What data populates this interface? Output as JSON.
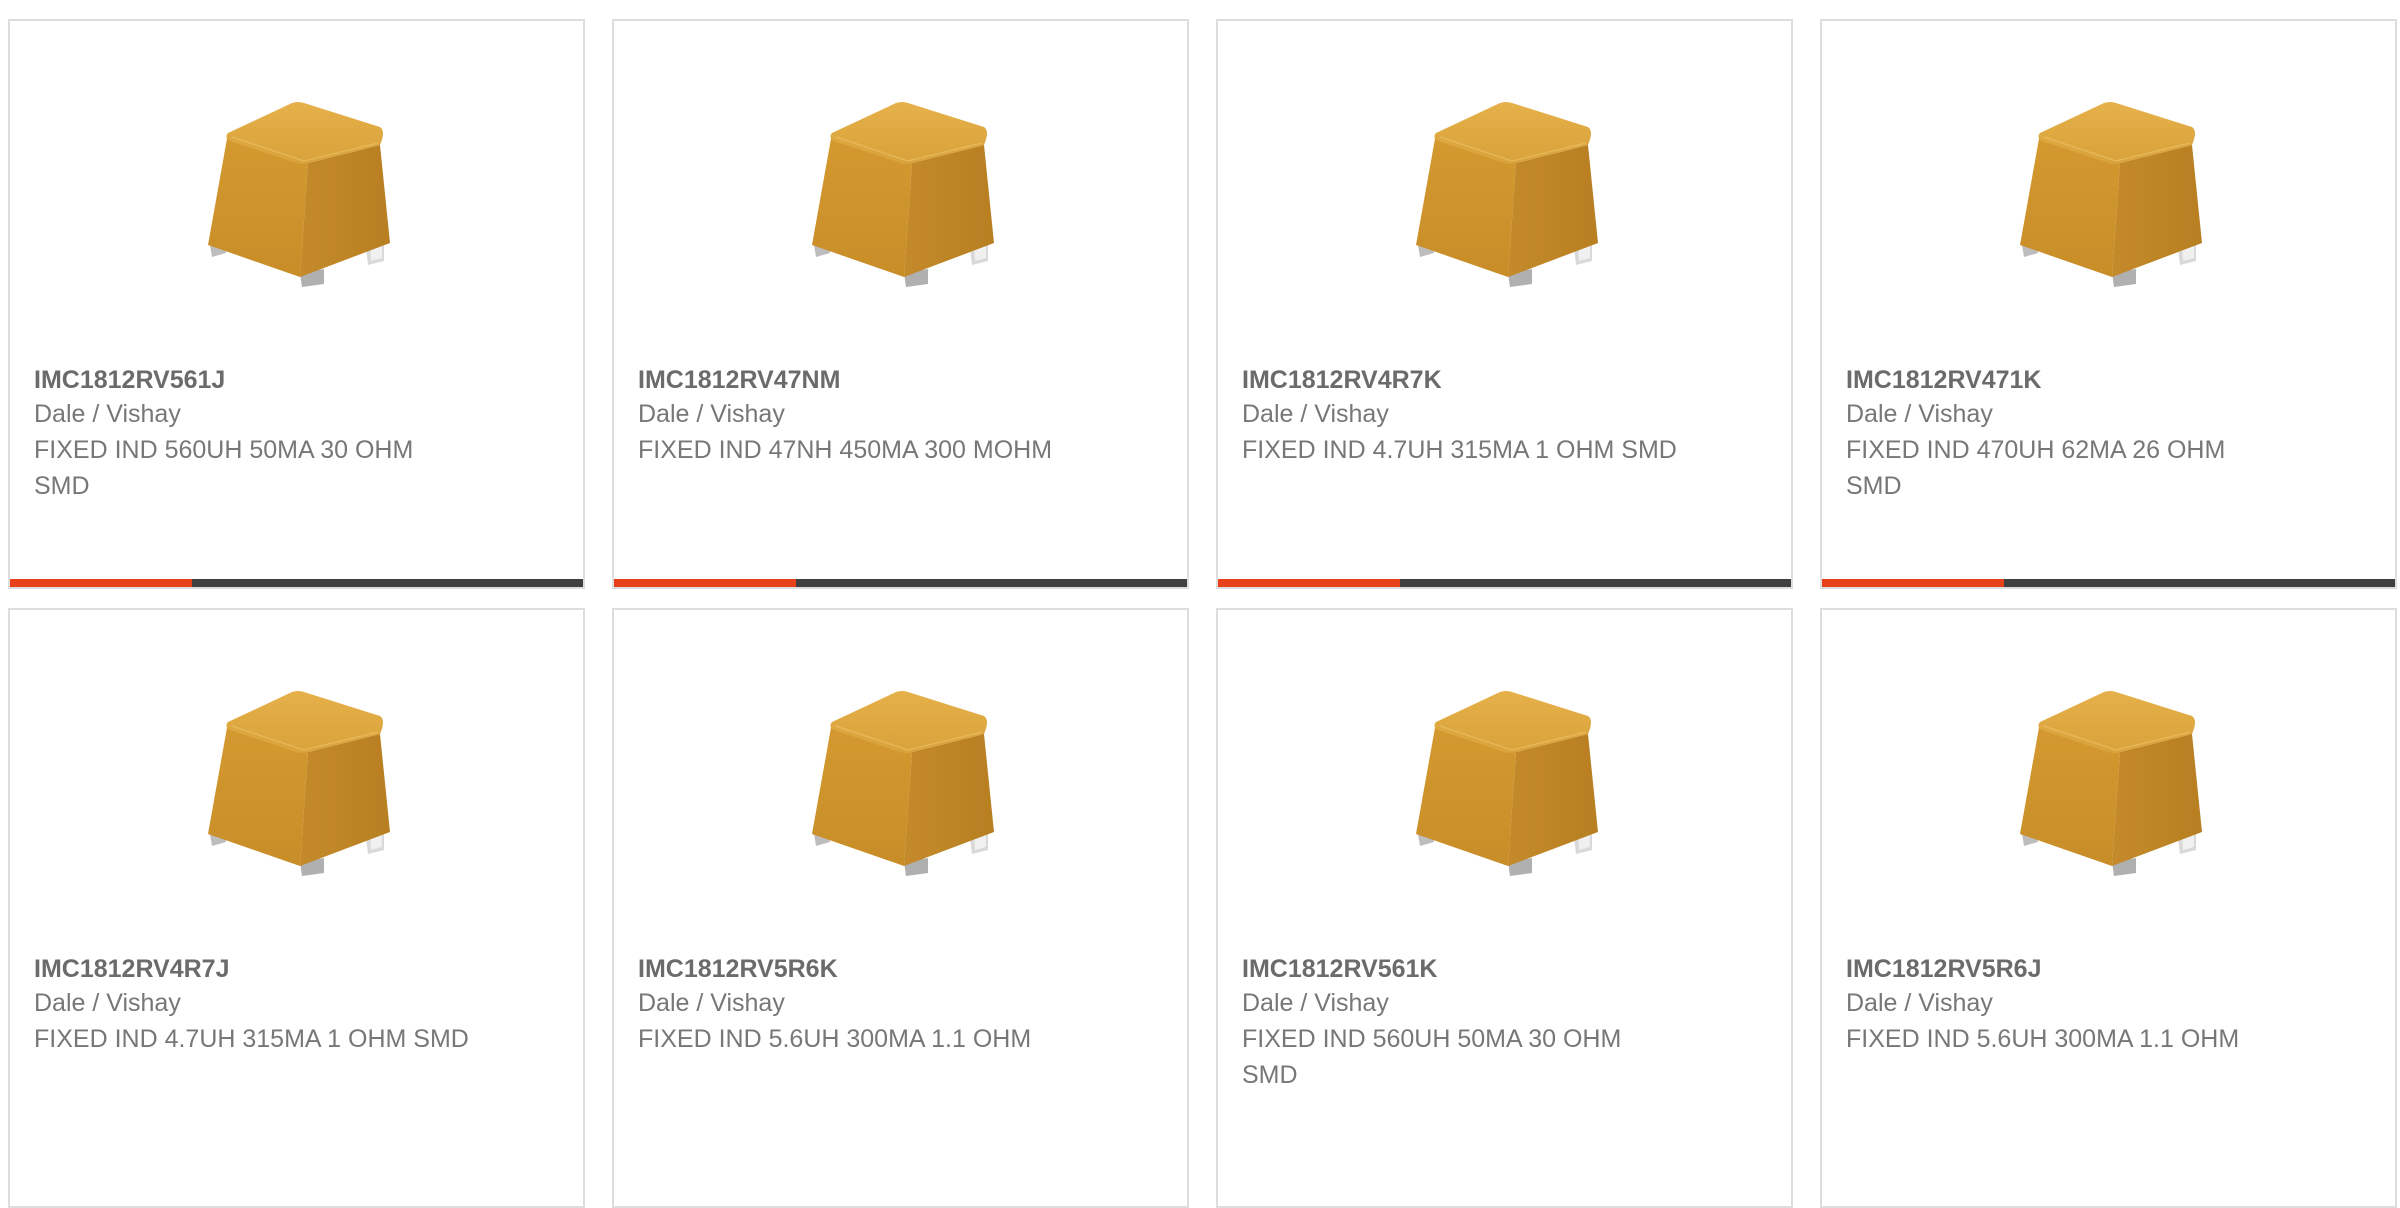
{
  "theme": {
    "accent": "#e8401a",
    "bar_track": "#404040",
    "card_border": "#dddddd",
    "component_body": "#d9a033",
    "component_terminal": "#cfcfcf"
  },
  "product_image_icon": "inductor-component-icon",
  "cards": [
    {
      "part_number": "IMC1812RV561J",
      "manufacturer": "Dale / Vishay",
      "description": "FIXED IND 560UH 50MA 30 OHM SMD"
    },
    {
      "part_number": "IMC1812RV47NM",
      "manufacturer": "Dale / Vishay",
      "description": "FIXED IND 47NH 450MA 300 MOHM"
    },
    {
      "part_number": "IMC1812RV4R7K",
      "manufacturer": "Dale / Vishay",
      "description": "FIXED IND 4.7UH 315MA 1 OHM SMD"
    },
    {
      "part_number": "IMC1812RV471K",
      "manufacturer": "Dale / Vishay",
      "description": "FIXED IND 470UH 62MA 26 OHM SMD"
    },
    {
      "part_number": "IMC1812RV4R7J",
      "manufacturer": "Dale / Vishay",
      "description": "FIXED IND 4.7UH 315MA 1 OHM SMD"
    },
    {
      "part_number": "IMC1812RV5R6K",
      "manufacturer": "Dale / Vishay",
      "description": "FIXED IND 5.6UH 300MA 1.1 OHM"
    },
    {
      "part_number": "IMC1812RV561K",
      "manufacturer": "Dale / Vishay",
      "description": "FIXED IND 560UH 50MA 30 OHM SMD"
    },
    {
      "part_number": "IMC1812RV5R6J",
      "manufacturer": "Dale / Vishay",
      "description": "FIXED IND 5.6UH 300MA 1.1 OHM"
    }
  ]
}
